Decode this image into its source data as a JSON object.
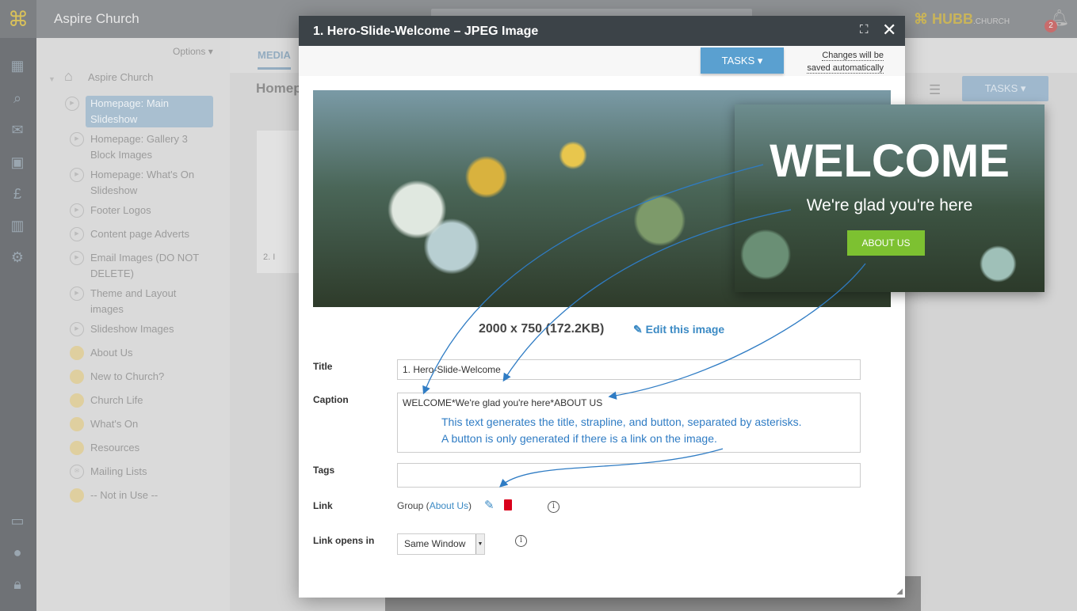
{
  "app": {
    "name": "Aspire Church",
    "brand": "HUBB",
    "brand_suffix": ".CHURCH",
    "notifications": "2"
  },
  "sidebar_icons": [
    "dashboard-icon",
    "search-icon",
    "mail-icon",
    "calendar-icon",
    "pound-icon",
    "chart-icon",
    "gear-icon",
    "monitor-icon",
    "user-icon",
    "lock-icon"
  ],
  "tree": {
    "options": "Options",
    "root": "Aspire Church",
    "items": [
      {
        "label": "Homepage: Main Slideshow",
        "type": "slideshow",
        "selected": true
      },
      {
        "label": "Homepage: Gallery 3 Block Images",
        "type": "slideshow"
      },
      {
        "label": "Homepage: What's On Slideshow",
        "type": "slideshow"
      },
      {
        "label": "Footer Logos",
        "type": "slideshow"
      },
      {
        "label": "Content page Adverts",
        "type": "slideshow"
      },
      {
        "label": "Email Images (DO NOT DELETE)",
        "type": "slideshow"
      },
      {
        "label": "Theme and Layout images",
        "type": "slideshow"
      },
      {
        "label": "Slideshow Images",
        "type": "slideshow"
      },
      {
        "label": "About Us",
        "type": "page"
      },
      {
        "label": "New to Church?",
        "type": "page"
      },
      {
        "label": "Church Life",
        "type": "page"
      },
      {
        "label": "What's On",
        "type": "page"
      },
      {
        "label": "Resources",
        "type": "page"
      },
      {
        "label": "Mailing Lists",
        "type": "mail"
      },
      {
        "label": "-- Not in Use --",
        "type": "page"
      }
    ]
  },
  "main": {
    "tab": "MEDIA",
    "heading": "Homepage: Main Slideshow",
    "tasks": "TASKS",
    "card_label": "2. I"
  },
  "modal": {
    "title": "1. Hero-Slide-Welcome – JPEG Image",
    "tasks": "TASKS",
    "autosave_line1": "Changes will be",
    "autosave_line2": "saved automatically",
    "dimensions": "2000 x 750 (172.2KB)",
    "edit": "Edit this image",
    "fields": {
      "title_label": "Title",
      "title_value": "1. Hero-Slide-Welcome",
      "caption_label": "Caption",
      "caption_value": "WELCOME*We're glad you're here*ABOUT US",
      "tags_label": "Tags",
      "tags_value": "",
      "link_label": "Link",
      "link_prefix": "Group (",
      "link_target": "About Us",
      "link_suffix": ")",
      "opens_label": "Link opens in",
      "opens_value": "Same Window"
    }
  },
  "annotation": {
    "line1": "This text generates the title, strapline, and button, separated by asterisks.",
    "line2": "A button is only generated if there is a link on the image."
  },
  "preview": {
    "title": "WELCOME",
    "strapline": "We're glad you're here",
    "button": "ABOUT US"
  },
  "colors": {
    "accent": "#5aa0d0",
    "button_green": "#7dc131",
    "delete_red": "#d9001b",
    "annotation_blue": "#2f7cc4"
  }
}
